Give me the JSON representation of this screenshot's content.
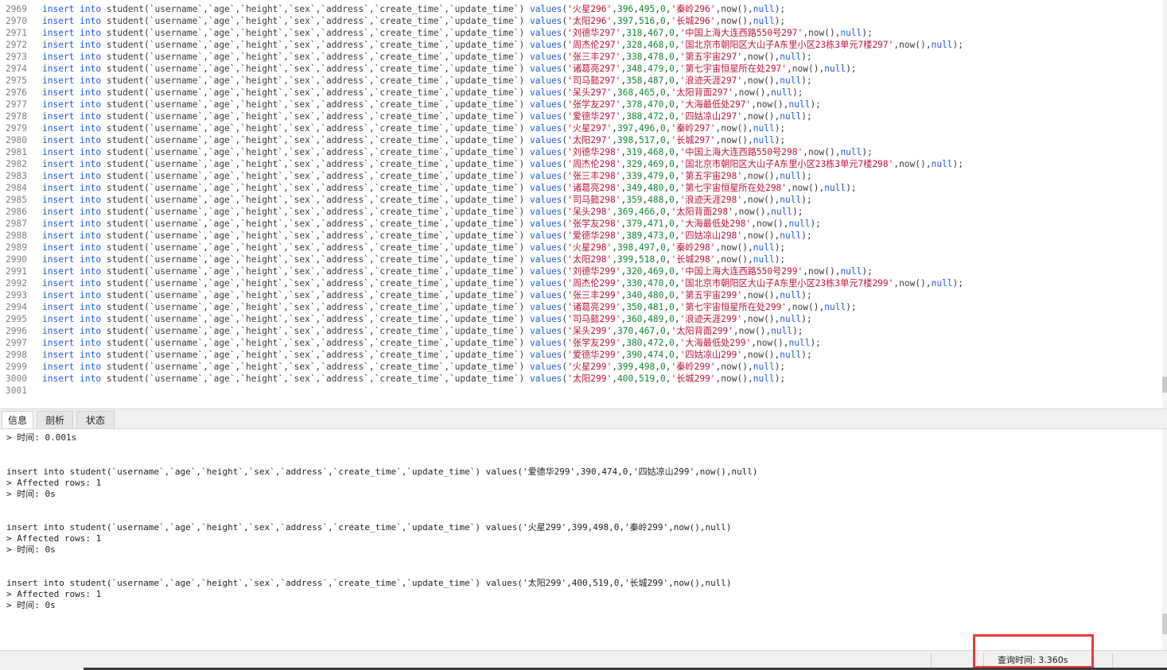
{
  "editor": {
    "lines": [
      {
        "n": "2969",
        "name": "火星296",
        "age": "396",
        "height": "495",
        "sex": "0",
        "addr": "秦岭296"
      },
      {
        "n": "2970",
        "name": "太阳296",
        "age": "397",
        "height": "516",
        "sex": "0",
        "addr": "长城296"
      },
      {
        "n": "2971",
        "name": "刘德华297",
        "age": "318",
        "height": "467",
        "sex": "0",
        "addr": "中国上海大连西路550号297"
      },
      {
        "n": "2972",
        "name": "周杰伦297",
        "age": "328",
        "height": "468",
        "sex": "0",
        "addr": "国北京市朝阳区大山子A东里小区23栋3单元7楼297"
      },
      {
        "n": "2973",
        "name": "张三丰297",
        "age": "338",
        "height": "478",
        "sex": "0",
        "addr": "第五宇宙297"
      },
      {
        "n": "2974",
        "name": "诸葛亮297",
        "age": "348",
        "height": "479",
        "sex": "0",
        "addr": "第七宇宙恒星所在处297"
      },
      {
        "n": "2975",
        "name": "司马懿297",
        "age": "358",
        "height": "487",
        "sex": "0",
        "addr": "浪迹天涯297"
      },
      {
        "n": "2976",
        "name": "呆头297",
        "age": "368",
        "height": "465",
        "sex": "0",
        "addr": "太阳背面297"
      },
      {
        "n": "2977",
        "name": "张学友297",
        "age": "378",
        "height": "470",
        "sex": "0",
        "addr": "大海最低处297"
      },
      {
        "n": "2978",
        "name": "爱德华297",
        "age": "388",
        "height": "472",
        "sex": "0",
        "addr": "四姑凉山297"
      },
      {
        "n": "2979",
        "name": "火星297",
        "age": "397",
        "height": "496",
        "sex": "0",
        "addr": "秦岭297"
      },
      {
        "n": "2980",
        "name": "太阳297",
        "age": "398",
        "height": "517",
        "sex": "0",
        "addr": "长城297"
      },
      {
        "n": "2981",
        "name": "刘德华298",
        "age": "319",
        "height": "468",
        "sex": "0",
        "addr": "中国上海大连西路550号298"
      },
      {
        "n": "2982",
        "name": "周杰伦298",
        "age": "329",
        "height": "469",
        "sex": "0",
        "addr": "国北京市朝阳区大山子A东里小区23栋3单元7楼298"
      },
      {
        "n": "2983",
        "name": "张三丰298",
        "age": "339",
        "height": "479",
        "sex": "0",
        "addr": "第五宇宙298"
      },
      {
        "n": "2984",
        "name": "诸葛亮298",
        "age": "349",
        "height": "480",
        "sex": "0",
        "addr": "第七宇宙恒星所在处298"
      },
      {
        "n": "2985",
        "name": "司马懿298",
        "age": "359",
        "height": "488",
        "sex": "0",
        "addr": "浪迹天涯298"
      },
      {
        "n": "2986",
        "name": "呆头298",
        "age": "369",
        "height": "466",
        "sex": "0",
        "addr": "太阳背面298"
      },
      {
        "n": "2987",
        "name": "张学友298",
        "age": "379",
        "height": "471",
        "sex": "0",
        "addr": "大海最低处298"
      },
      {
        "n": "2988",
        "name": "爱德华298",
        "age": "389",
        "height": "473",
        "sex": "0",
        "addr": "四姑凉山298"
      },
      {
        "n": "2989",
        "name": "火星298",
        "age": "398",
        "height": "497",
        "sex": "0",
        "addr": "秦岭298"
      },
      {
        "n": "2990",
        "name": "太阳298",
        "age": "399",
        "height": "518",
        "sex": "0",
        "addr": "长城298"
      },
      {
        "n": "2991",
        "name": "刘德华299",
        "age": "320",
        "height": "469",
        "sex": "0",
        "addr": "中国上海大连西路550号299"
      },
      {
        "n": "2992",
        "name": "周杰伦299",
        "age": "330",
        "height": "470",
        "sex": "0",
        "addr": "国北京市朝阳区大山子A东里小区23栋3单元7楼299"
      },
      {
        "n": "2993",
        "name": "张三丰299",
        "age": "340",
        "height": "480",
        "sex": "0",
        "addr": "第五宇宙299"
      },
      {
        "n": "2994",
        "name": "诸葛亮299",
        "age": "350",
        "height": "481",
        "sex": "0",
        "addr": "第七宇宙恒星所在处299"
      },
      {
        "n": "2995",
        "name": "司马懿299",
        "age": "360",
        "height": "489",
        "sex": "0",
        "addr": "浪迹天涯299"
      },
      {
        "n": "2996",
        "name": "呆头299",
        "age": "370",
        "height": "467",
        "sex": "0",
        "addr": "太阳背面299"
      },
      {
        "n": "2997",
        "name": "张学友299",
        "age": "380",
        "height": "472",
        "sex": "0",
        "addr": "大海最低处299"
      },
      {
        "n": "2998",
        "name": "爱德华299",
        "age": "390",
        "height": "474",
        "sex": "0",
        "addr": "四姑凉山299"
      },
      {
        "n": "2999",
        "name": "火星299",
        "age": "399",
        "height": "498",
        "sex": "0",
        "addr": "秦岭299"
      },
      {
        "n": "3000",
        "name": "太阳299",
        "age": "400",
        "height": "519",
        "sex": "0",
        "addr": "长城299"
      }
    ],
    "empty_line_number": "3001",
    "kw_insert": "insert",
    "kw_into": "into",
    "table_cols": "student(`username`,`age`,`height`,`sex`,`address`,`create_time`,`update_time`)",
    "kw_values": "values",
    "fn_now": "now()",
    "kw_null": "null"
  },
  "tabs": [
    {
      "label": "信息",
      "active": true
    },
    {
      "label": "剖析",
      "active": false
    },
    {
      "label": "状态",
      "active": false
    }
  ],
  "output": {
    "first_time": "> 时间: 0.001s",
    "entries": [
      {
        "sql": "insert into student(`username`,`age`,`height`,`sex`,`address`,`create_time`,`update_time`) values('爱德华299',390,474,0,'四姑凉山299',now(),null)",
        "rows": "> Affected rows: 1",
        "time": "> 时间: 0s"
      },
      {
        "sql": "insert into student(`username`,`age`,`height`,`sex`,`address`,`create_time`,`update_time`) values('火星299',399,498,0,'秦岭299',now(),null)",
        "rows": "> Affected rows: 1",
        "time": "> 时间: 0s"
      },
      {
        "sql": "insert into student(`username`,`age`,`height`,`sex`,`address`,`create_time`,`update_time`) values('太阳299',400,519,0,'长城299',now(),null)",
        "rows": "> Affected rows: 1",
        "time": "> 时间: 0s"
      }
    ]
  },
  "status": {
    "query_time": "查询时间: 3.360s"
  },
  "colors": {
    "keyword": "#1e5ed8",
    "string": "#c0143c",
    "number": "#0c8a2a",
    "highlight": "#e63b3b"
  }
}
